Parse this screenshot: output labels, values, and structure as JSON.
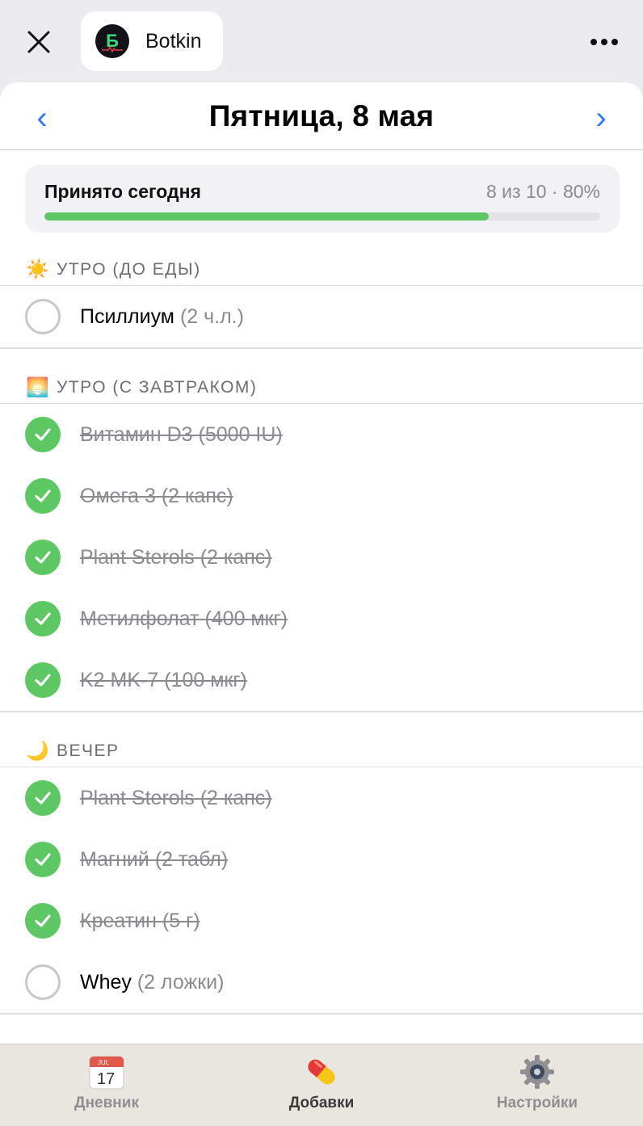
{
  "header": {
    "app_name": "Botkin",
    "logo_letter": "Б",
    "close_icon": "close-icon",
    "more_icon": "more-horizontal-icon"
  },
  "datebar": {
    "prev": "‹",
    "title": "Пятница, 8 мая",
    "next": "›"
  },
  "progress": {
    "label": "Принято сегодня",
    "stats": "8 из 10 · 80%",
    "fraction": 0.8
  },
  "sections": [
    {
      "icon": "☀️",
      "title": "УТРО (ДО ЕДЫ)",
      "items": [
        {
          "name": "Псиллиум",
          "dose": "(2 ч.л.)",
          "done": false
        }
      ]
    },
    {
      "icon": "🌅",
      "title": "УТРО (С ЗАВТРАКОМ)",
      "items": [
        {
          "name": "Витамин D3",
          "dose": "(5000 IU)",
          "done": true
        },
        {
          "name": "Омега 3",
          "dose": "(2 капс)",
          "done": true
        },
        {
          "name": "Plant Sterols",
          "dose": "(2 капс)",
          "done": true
        },
        {
          "name": "Метилфолат",
          "dose": "(400 мкг)",
          "done": true
        },
        {
          "name": "K2 MK-7",
          "dose": "(100 мкг)",
          "done": true
        }
      ]
    },
    {
      "icon": "🌙",
      "title": "ВЕЧЕР",
      "items": [
        {
          "name": "Plant Sterols",
          "dose": "(2 капс)",
          "done": true
        },
        {
          "name": "Магний",
          "dose": "(2 табл)",
          "done": true
        },
        {
          "name": "Креатин",
          "dose": "(5 г)",
          "done": true
        },
        {
          "name": "Whey",
          "dose": "(2 ложки)",
          "done": false
        }
      ]
    }
  ],
  "tabs": [
    {
      "label": "Дневник",
      "icon": "calendar-icon",
      "icon_month": "JUL",
      "icon_day": "17",
      "active": false
    },
    {
      "label": "Добавки",
      "icon": "pill-icon",
      "active": true
    },
    {
      "label": "Настройки",
      "icon": "gear-icon",
      "active": false
    }
  ],
  "colors": {
    "accent": "#3478f6",
    "done": "#5cc763",
    "muted": "#8a8a8f"
  }
}
